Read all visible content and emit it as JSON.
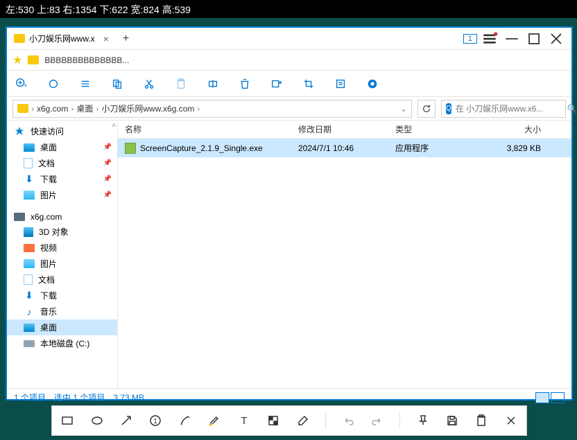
{
  "coords": "左:530  上:83  右:1354  下:622  宽:824  高:539",
  "tab": {
    "title": "小刀娱乐网www.x"
  },
  "window_badge": "1",
  "bookmark": "BBBBBBBBBBBBBB...",
  "breadcrumb": {
    "items": [
      "x6g.com",
      "桌面",
      "小刀娱乐网www.x6g.com"
    ]
  },
  "search_placeholder": "在 小刀娱乐网www.x6...",
  "columns": {
    "name": "名称",
    "date": "修改日期",
    "type": "类型",
    "size": "大小"
  },
  "files": [
    {
      "name": "ScreenCapture_2.1.9_Single.exe",
      "date": "2024/7/1 10:46",
      "type": "应用程序",
      "size": "3,829 KB"
    }
  ],
  "sidebar": {
    "quick": {
      "label": "快速访问",
      "items": [
        "桌面",
        "文档",
        "下载",
        "图片"
      ]
    },
    "pc": {
      "label": "x6g.com",
      "items": [
        "3D 对象",
        "视频",
        "图片",
        "文档",
        "下载",
        "音乐",
        "桌面",
        "本地磁盘 (C:)"
      ]
    }
  },
  "status": {
    "count": "1 个项目",
    "selected": "选中 1 个项目",
    "size": "3.73 MB"
  }
}
